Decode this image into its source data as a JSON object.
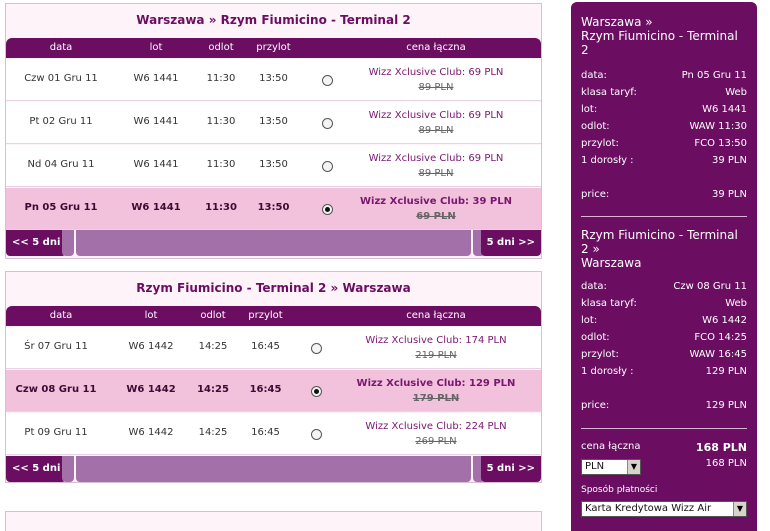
{
  "outbound": {
    "title": "Warszawa » Rzym Fiumicino - Terminal 2",
    "headers": {
      "data": "data",
      "lot": "lot",
      "odlot": "odlot",
      "przylot": "przylot",
      "cena": "cena łączna"
    },
    "rows": [
      {
        "date": "Czw 01 Gru 11",
        "flight": "W6 1441",
        "dep": "11:30",
        "arr": "13:50",
        "price": "Wizz Xclusive Club: 69 PLN",
        "old": "89 PLN",
        "selected": false
      },
      {
        "date": "Pt 02 Gru 11",
        "flight": "W6 1441",
        "dep": "11:30",
        "arr": "13:50",
        "price": "Wizz Xclusive Club: 69 PLN",
        "old": "89 PLN",
        "selected": false
      },
      {
        "date": "Nd 04 Gru 11",
        "flight": "W6 1441",
        "dep": "11:30",
        "arr": "13:50",
        "price": "Wizz Xclusive Club: 69 PLN",
        "old": "89 PLN",
        "selected": false
      },
      {
        "date": "Pn 05 Gru 11",
        "flight": "W6 1441",
        "dep": "11:30",
        "arr": "13:50",
        "price": "Wizz Xclusive Club: 39 PLN",
        "old": "69 PLN",
        "selected": true
      }
    ],
    "prev": "<< 5 dni",
    "next": "5 dni >>"
  },
  "inbound": {
    "title": "Rzym Fiumicino - Terminal 2 » Warszawa",
    "headers": {
      "data": "data",
      "lot": "lot",
      "odlot": "odlot",
      "przylot": "przylot",
      "cena": "cena łączna"
    },
    "rows": [
      {
        "date": "Śr 07 Gru 11",
        "flight": "W6 1442",
        "dep": "14:25",
        "arr": "16:45",
        "price": "Wizz Xclusive Club: 174 PLN",
        "old": "219 PLN",
        "selected": false
      },
      {
        "date": "Czw 08 Gru 11",
        "flight": "W6 1442",
        "dep": "14:25",
        "arr": "16:45",
        "price": "Wizz Xclusive Club: 129 PLN",
        "old": "179 PLN",
        "selected": true
      },
      {
        "date": "Pt 09 Gru 11",
        "flight": "W6 1442",
        "dep": "14:25",
        "arr": "16:45",
        "price": "Wizz Xclusive Club: 224 PLN",
        "old": "269 PLN",
        "selected": false
      }
    ],
    "prev": "<< 5 dni",
    "next": "5 dni >>"
  },
  "summary": {
    "out": {
      "route_line1": "Warszawa »",
      "route_line2": "Rzym Fiumicino - Terminal",
      "route_line3": "2",
      "items": [
        {
          "k": "data:",
          "v": "Pn 05 Gru 11"
        },
        {
          "k": "klasa taryf:",
          "v": "Web"
        },
        {
          "k": "lot:",
          "v": "W6 1441"
        },
        {
          "k": "odlot:",
          "v": "WAW 11:30"
        },
        {
          "k": "przylot:",
          "v": "FCO 13:50"
        },
        {
          "k": "1 dorosły :",
          "v": "39 PLN"
        }
      ],
      "price_label": "price:",
      "price": "39 PLN"
    },
    "ret": {
      "route_line1": "Rzym Fiumicino - Terminal",
      "route_line2": "2 »",
      "route_line3": "Warszawa",
      "items": [
        {
          "k": "data:",
          "v": "Czw 08 Gru 11"
        },
        {
          "k": "klasa taryf:",
          "v": "Web"
        },
        {
          "k": "lot:",
          "v": "W6 1442"
        },
        {
          "k": "odlot:",
          "v": "FCO 14:25"
        },
        {
          "k": "przylot:",
          "v": "WAW 16:45"
        },
        {
          "k": "1 dorosły :",
          "v": "129 PLN"
        }
      ],
      "price_label": "price:",
      "price": "129 PLN"
    },
    "total_label": "cena łączna",
    "total": "168 PLN",
    "total_sub": "168 PLN",
    "currency": "PLN",
    "payment_label": "Sposób płatności",
    "payment": "Karta Kredytowa Wizz Air"
  }
}
